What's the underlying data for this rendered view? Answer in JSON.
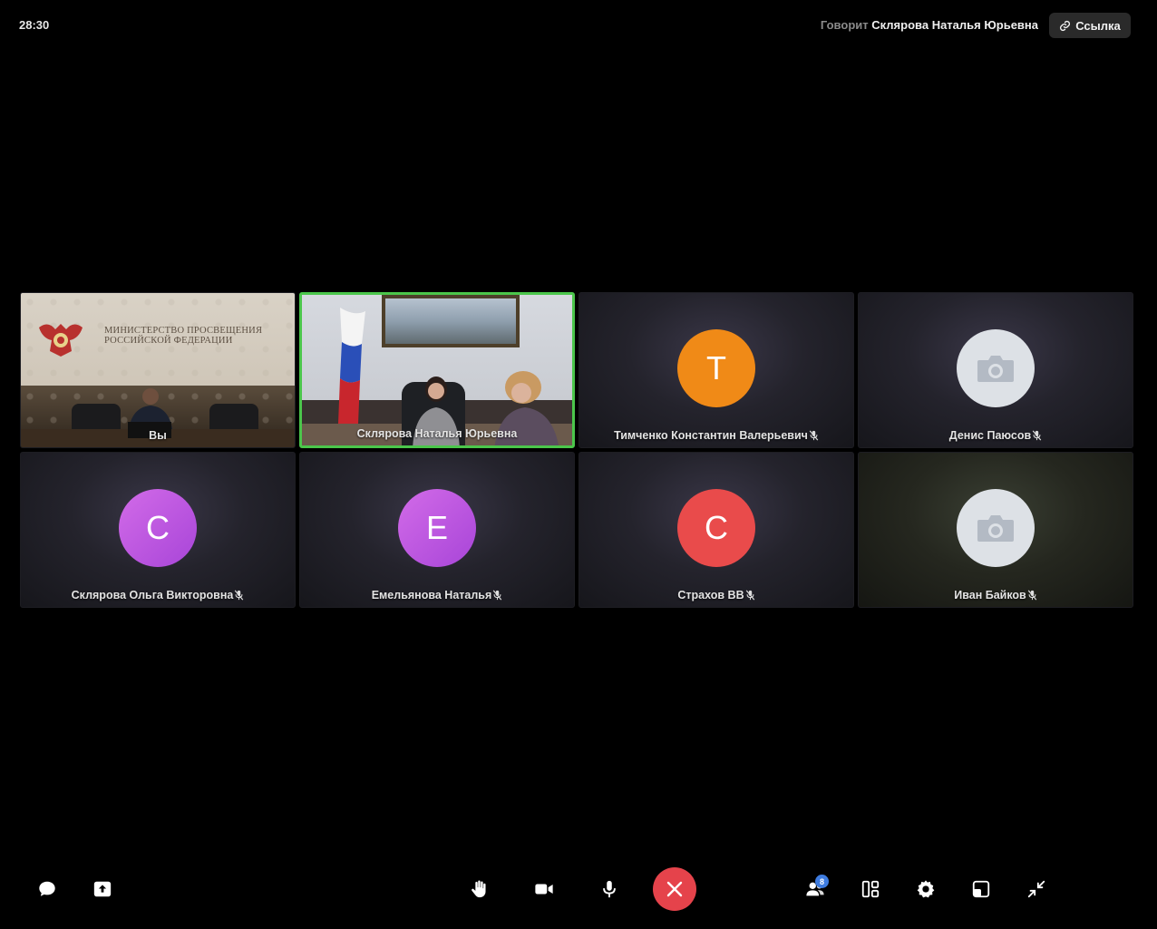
{
  "header": {
    "timer": "28:30",
    "speaking_prefix": "Говорит",
    "speaking_name": "Склярова Наталья Юрьевна",
    "link_label": "Ссылка"
  },
  "tiles": [
    {
      "name": "Вы",
      "type": "video",
      "muted": false,
      "scene_text": "МИНИСТЕРСТВО ПРОСВЕЩЕНИЯ\nРОССИЙСКОЙ ФЕДЕРАЦИИ"
    },
    {
      "name": "Склярова Наталья Юрьевна",
      "type": "video",
      "muted": false,
      "active_speaker": true
    },
    {
      "name": "Тимченко Константин Валерьевич",
      "type": "avatar",
      "initial": "Т",
      "color": "#f08a17",
      "muted": true
    },
    {
      "name": "Денис Паюсов",
      "type": "camera-placeholder",
      "muted": true
    },
    {
      "name": "Склярова Ольга Викторовна",
      "type": "avatar",
      "initial": "С",
      "color": "#c05ae2",
      "muted": true
    },
    {
      "name": "Емельянова Наталья",
      "type": "avatar",
      "initial": "Е",
      "color": "#c05ae2",
      "muted": true
    },
    {
      "name": "Страхов ВВ",
      "type": "avatar",
      "initial": "С",
      "color": "#e94b4b",
      "muted": true
    },
    {
      "name": "Иван Байков",
      "type": "camera-placeholder",
      "muted": true
    }
  ],
  "toolbar": {
    "participants_count": "8",
    "buttons": [
      "chat-icon",
      "share-screen-icon",
      "raise-hand-icon",
      "camera-icon",
      "microphone-icon",
      "end-call-icon",
      "participants-icon",
      "layout-icon",
      "settings-icon",
      "pip-icon",
      "exit-fullscreen-icon"
    ],
    "accent_end_call": "#e5434b",
    "active_speaker_border": "#4bc64b"
  }
}
